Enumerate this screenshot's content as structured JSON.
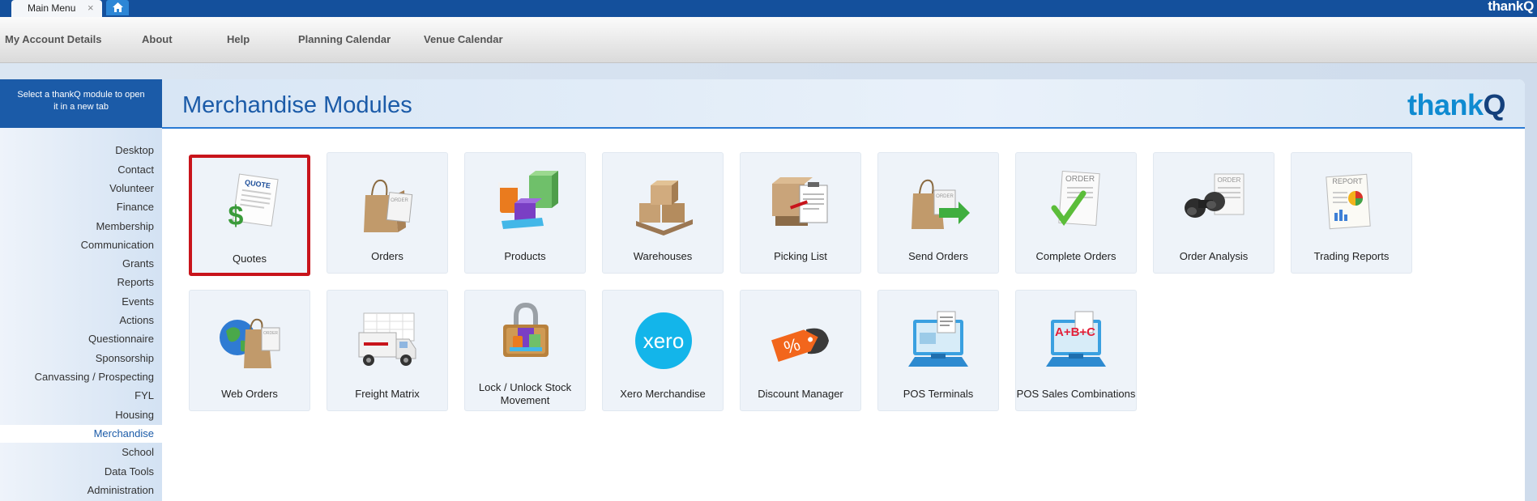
{
  "tabbar": {
    "tab_label": "Main Menu",
    "close_glyph": "×",
    "brand": "thankQ"
  },
  "nav": {
    "items": [
      {
        "label": "My Account Details"
      },
      {
        "label": "About"
      },
      {
        "label": "Help"
      },
      {
        "label": "Planning Calendar"
      },
      {
        "label": "Venue Calendar"
      }
    ]
  },
  "sidebar": {
    "heading": "Select a thankQ module to open it in a new tab",
    "items": [
      {
        "label": "Desktop"
      },
      {
        "label": "Contact"
      },
      {
        "label": "Volunteer"
      },
      {
        "label": "Finance"
      },
      {
        "label": "Membership"
      },
      {
        "label": "Communication"
      },
      {
        "label": "Grants"
      },
      {
        "label": "Reports"
      },
      {
        "label": "Events"
      },
      {
        "label": "Actions"
      },
      {
        "label": "Questionnaire"
      },
      {
        "label": "Sponsorship"
      },
      {
        "label": "Canvassing / Prospecting"
      },
      {
        "label": "FYL"
      },
      {
        "label": "Housing"
      },
      {
        "label": "Merchandise"
      },
      {
        "label": "School"
      },
      {
        "label": "Data Tools"
      },
      {
        "label": "Administration"
      }
    ],
    "active_item": "Merchandise"
  },
  "main": {
    "title": "Merchandise Modules",
    "logo": {
      "text": "thank",
      "q": "Q"
    },
    "modules": [
      {
        "label": "Quotes",
        "icon": "quote-icon",
        "selected": true,
        "icon_text": "QUOTE"
      },
      {
        "label": "Orders",
        "icon": "shopping-bag-order-icon",
        "icon_text": "ORDER"
      },
      {
        "label": "Products",
        "icon": "products-icon"
      },
      {
        "label": "Warehouses",
        "icon": "warehouse-boxes-icon"
      },
      {
        "label": "Picking List",
        "icon": "picking-list-icon"
      },
      {
        "label": "Send Orders",
        "icon": "send-orders-icon",
        "icon_text": "ORDER"
      },
      {
        "label": "Complete Orders",
        "icon": "complete-orders-icon",
        "icon_text": "ORDER"
      },
      {
        "label": "Order Analysis",
        "icon": "binoculars-icon",
        "icon_text": "ORDER"
      },
      {
        "label": "Trading Reports",
        "icon": "trading-reports-icon",
        "icon_text": "REPORT"
      },
      {
        "label": "Web Orders",
        "icon": "web-orders-icon",
        "icon_text": "ORDER"
      },
      {
        "label": "Freight Matrix",
        "icon": "freight-truck-icon"
      },
      {
        "label": "Lock / Unlock Stock Movement",
        "icon": "lock-stock-icon"
      },
      {
        "label": "Xero Merchandise",
        "icon": "xero-icon",
        "icon_text": "xero"
      },
      {
        "label": "Discount Manager",
        "icon": "discount-tag-icon",
        "icon_text": "%"
      },
      {
        "label": "POS Terminals",
        "icon": "pos-terminal-icon"
      },
      {
        "label": "POS Sales Combinations",
        "icon": "pos-combination-icon",
        "icon_text": "A+B+C"
      }
    ]
  },
  "colors": {
    "brand_blue": "#14509c",
    "title_blue": "#1b5ba8",
    "selected_border": "#c8141b",
    "tile_bg": "#eef3f9"
  }
}
